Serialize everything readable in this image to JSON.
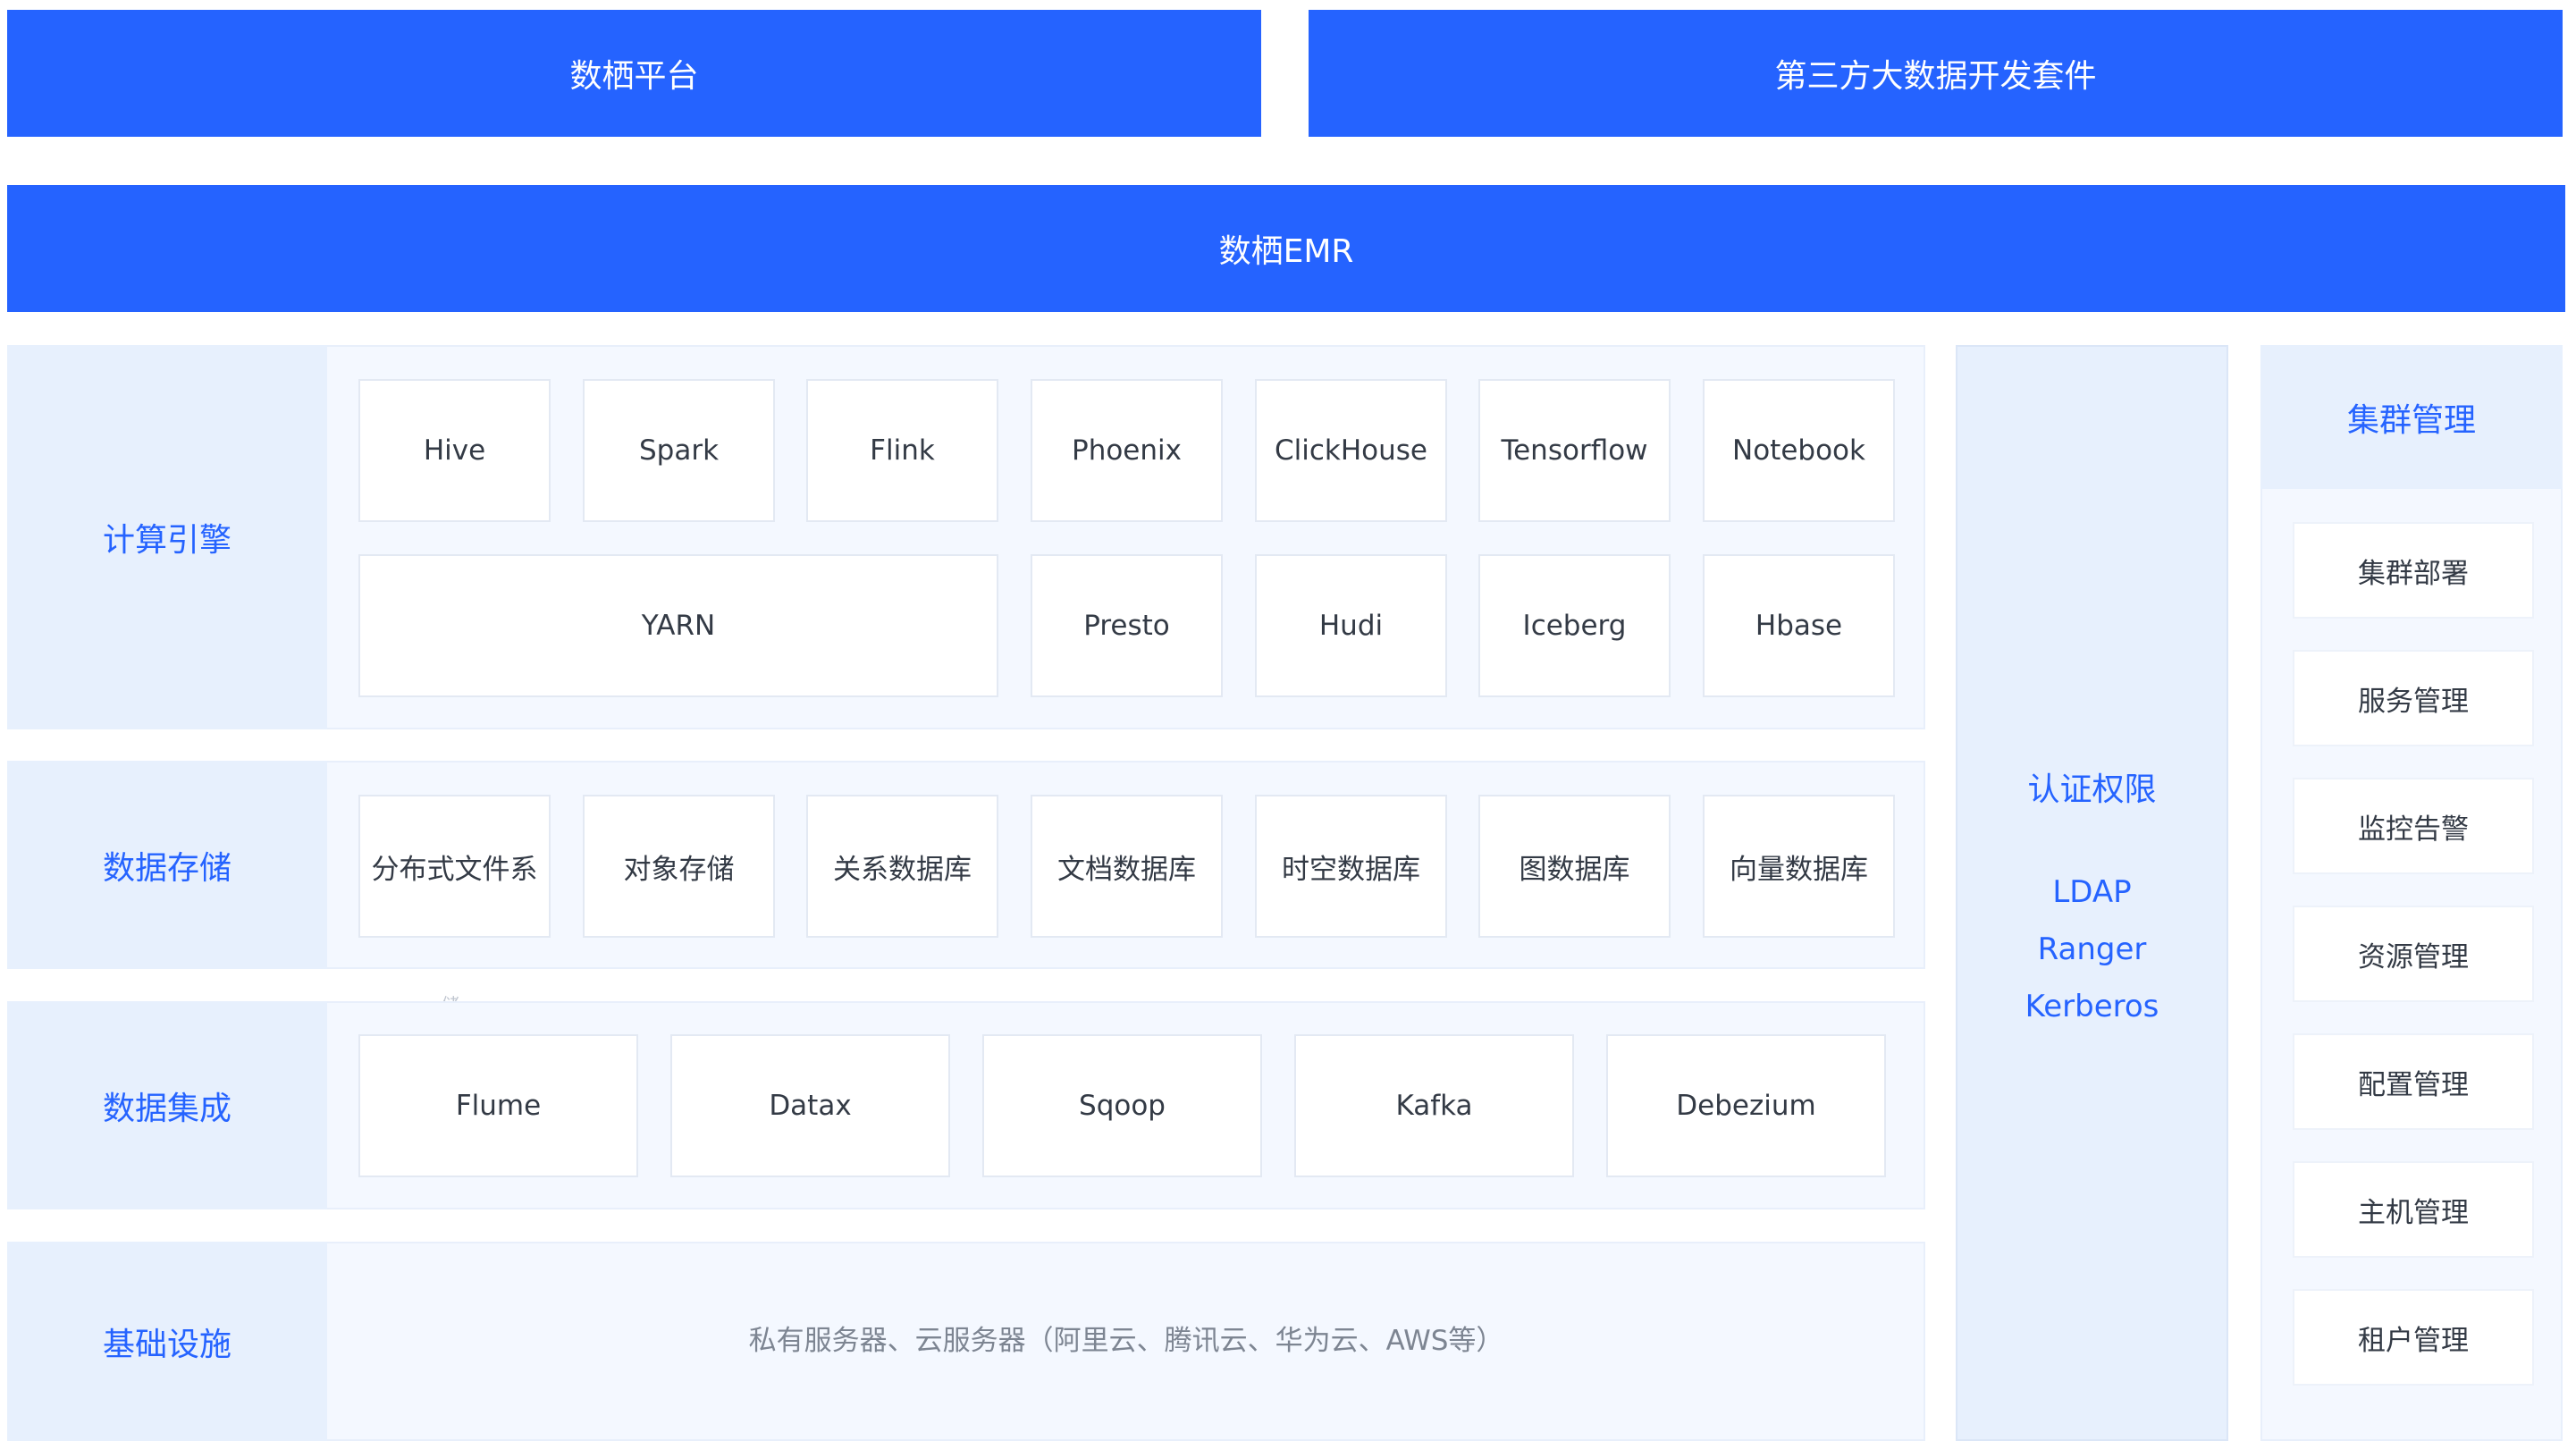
{
  "top": {
    "left": "数栖平台",
    "right": "第三方大数据开发套件",
    "emr": "数栖EMR"
  },
  "compute": {
    "label": "计算引擎",
    "row1": [
      "Hive",
      "Spark",
      "Flink",
      "Phoenix",
      "ClickHouse",
      "Tensorflow",
      "Notebook"
    ],
    "row2": [
      "YARN",
      "Presto",
      "Hudi",
      "Iceberg",
      "Hbase"
    ]
  },
  "storage": {
    "label": "数据存储",
    "items": [
      "分布式文件系",
      "对象存储",
      "关系数据库",
      "文档数据库",
      "时空数据库",
      "图数据库",
      "向量数据库"
    ],
    "stray": "储"
  },
  "integration": {
    "label": "数据集成",
    "items": [
      "Flume",
      "Datax",
      "Sqoop",
      "Kafka",
      "Debezium"
    ]
  },
  "infra": {
    "label": "基础设施",
    "text": "私有服务器、云服务器（阿里云、腾讯云、华为云、AWS等）"
  },
  "auth": {
    "title": "认证权限",
    "items": [
      "LDAP",
      "Ranger",
      "Kerberos"
    ]
  },
  "cluster": {
    "title": "集群管理",
    "items": [
      "集群部署",
      "服务管理",
      "监控告警",
      "资源管理",
      "配置管理",
      "主机管理",
      "租户管理"
    ]
  },
  "colors": {
    "primary": "#2563ff",
    "panel_bg": "#f4f8ff",
    "label_bg": "#e7f0fd"
  }
}
